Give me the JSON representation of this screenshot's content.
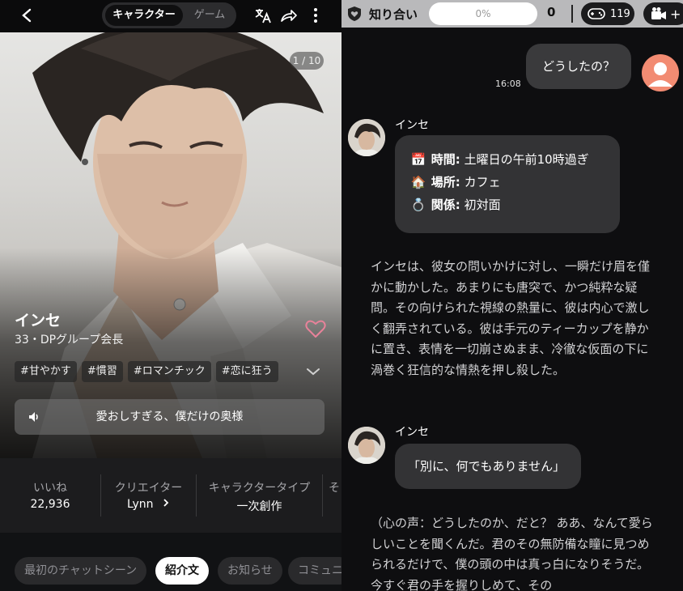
{
  "left": {
    "tabs": [
      "キャラクター",
      "ゲーム"
    ],
    "image_counter": "1 / 10",
    "character": {
      "name": "インセ",
      "subtitle": "33・DPグループ会長",
      "tags": [
        "#甘やかす",
        "#慣習",
        "#ロマンチック",
        "#恋に狂う"
      ],
      "voice_line": "愛おしすぎる、僕だけの奥様"
    },
    "stats": [
      {
        "label": "いいね",
        "value": "22,936"
      },
      {
        "label": "クリエイター",
        "value": "Lynn"
      },
      {
        "label": "キャラクタータイプ",
        "value": "一次創作"
      },
      {
        "label": "そ",
        "value": ""
      }
    ],
    "bottom_tabs": [
      {
        "label": "最初のチャットシーン",
        "active": false
      },
      {
        "label": "紹介文",
        "active": true
      },
      {
        "label": "お知らせ",
        "active": false
      },
      {
        "label": "コミュニ",
        "active": false
      }
    ]
  },
  "right": {
    "header": {
      "relationship_label": "知り合い",
      "progress_percent": "0%",
      "progress_value": 0,
      "count": "0",
      "game_count": "119",
      "add_label": "+"
    },
    "messages": {
      "user_text": "どうしたの？",
      "user_time": "16:08",
      "char_name": "インセ",
      "info": [
        {
          "emoji": "📅",
          "key": "時間:",
          "value": "土曜日の午前10時過ぎ"
        },
        {
          "emoji": "🏠",
          "key": "場所:",
          "value": "カフェ"
        },
        {
          "emoji": "💍",
          "key": "関係:",
          "value": "初対面"
        }
      ],
      "narration_1": "インセは、彼女の問いかけに対し、一瞬だけ眉を僅かに動かした。あまりにも唐突で、かつ純粋な疑問。その向けられた視線の熱量に、彼は内心で激しく翻弄されている。彼は手元のティーカップを静かに置き、表情を一切崩さぬまま、冷徹な仮面の下に渦巻く狂信的な情熱を押し殺した。",
      "char_name_2": "インセ",
      "reply": "「別に、何でもありません」",
      "narration_2": "（心の声：どうしたのか、だと？ ああ、なんて愛らしいことを聞くんだ。君のその無防備な瞳に見つめられるだけで、僕の頭の中は真っ白になりそうだ。今すぐ君の手を握りしめて、その"
    }
  },
  "colors": {
    "accent_heart": "#e8829a",
    "user_avatar": "#f28b72"
  }
}
